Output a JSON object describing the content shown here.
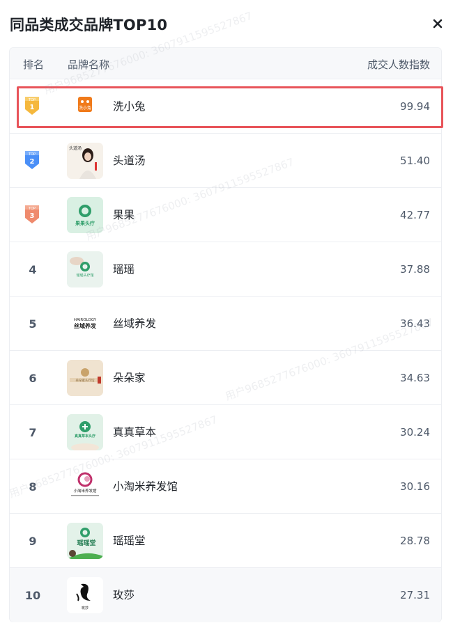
{
  "panel": {
    "title": "同品类成交品牌TOP10",
    "close_icon": "close-icon"
  },
  "table": {
    "headers": {
      "rank": "排名",
      "brand": "品牌名称",
      "index": "成交人数指数"
    },
    "rows": [
      {
        "rank": "1",
        "medal": "gold-medal-icon",
        "medal_label": "TOP",
        "name": "洗小兔",
        "value": "99.94",
        "logo_text": "洗小兔",
        "highlighted": true
      },
      {
        "rank": "2",
        "medal": "blue-medal-icon",
        "medal_label": "TOP",
        "name": "头道汤",
        "value": "51.40",
        "logo_text": "头道汤"
      },
      {
        "rank": "3",
        "medal": "bronze-medal-icon",
        "medal_label": "TOP",
        "name": "果果",
        "value": "42.77",
        "logo_text": "果果头疗"
      },
      {
        "rank": "4",
        "name": "瑶瑶",
        "value": "37.88",
        "logo_text": "瑶瑶头疗馆"
      },
      {
        "rank": "5",
        "name": "丝域养发",
        "value": "36.43",
        "logo_text_top": "HAIROLOGY",
        "logo_text": "丝域养发"
      },
      {
        "rank": "6",
        "name": "朵朵家",
        "value": "34.63",
        "logo_text": "朵朵家头疗馆"
      },
      {
        "rank": "7",
        "name": "真真草本",
        "value": "30.24",
        "logo_text": "真真草本头疗"
      },
      {
        "rank": "8",
        "name": "小淘米养发馆",
        "value": "30.16",
        "logo_text": "小淘米养发馆"
      },
      {
        "rank": "9",
        "name": "瑶瑶堂",
        "value": "28.78",
        "logo_text": "瑶瑶堂"
      },
      {
        "rank": "10",
        "name": "玫莎",
        "value": "27.31",
        "logo_text": "玫莎"
      }
    ]
  },
  "watermark": {
    "text": "用户9685277676000: 3607911595527867",
    "color": "#969ca8"
  },
  "colors": {
    "highlight_border": "#e8545a",
    "gold": "#f5b83d",
    "blue": "#4a8ff7",
    "bronze": "#ef8a6d",
    "header_bg": "#f7f8fa",
    "text_primary": "#1f2329",
    "text_secondary": "#4e5969"
  }
}
